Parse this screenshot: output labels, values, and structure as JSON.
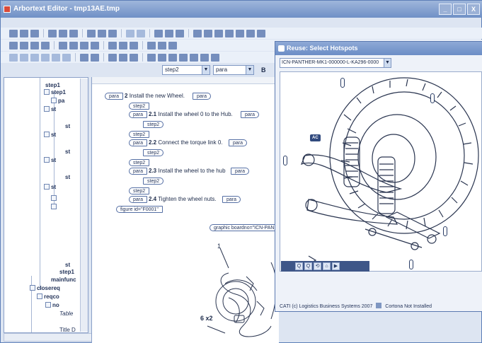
{
  "window": {
    "title": "Arbortext Editor - tmp13AE.tmp",
    "buttons": [
      "_",
      "□",
      "X"
    ]
  },
  "toolbar": {
    "style_combo": "step2",
    "element_combo": "para",
    "bold_label": "B"
  },
  "tree": {
    "rows": [
      {
        "label": "step1"
      },
      {
        "label": "step1"
      },
      {
        "label": "pa"
      },
      {
        "label": "st"
      },
      {
        "label": "st"
      },
      {
        "label": "st"
      },
      {
        "label": "st"
      },
      {
        "label": "st"
      },
      {
        "label": "st"
      },
      {
        "label": "st"
      },
      {
        "label": "step1"
      },
      {
        "label": "mainfunc"
      },
      {
        "label": "closereq"
      },
      {
        "label": "reqco"
      },
      {
        "label": "no"
      },
      {
        "label": "Table"
      },
      {
        "label": "Title D"
      }
    ]
  },
  "editor": {
    "tag_para": "para",
    "tag_step2": "step2",
    "lines": [
      {
        "num": "2",
        "text": "Install the new Wheel."
      },
      {
        "num": "2.1",
        "text": "Install the wheel 0 to the Hub."
      },
      {
        "num": "2.2",
        "text": "Connect the torque link 0."
      },
      {
        "num": "2.3",
        "text": "Install the wheel to the hub"
      },
      {
        "num": "2.4",
        "text": "Tighten the wheel nuts."
      }
    ],
    "figure_tag": "figure id=\"F0001\"",
    "graphic_tag": "graphic boardno=\"ICN-PAN",
    "drawing_labels": [
      "1",
      "6 x2"
    ]
  },
  "dialog": {
    "title": "Reuse: Select Hotspots",
    "hotspot_value": "ICN-PANTHER-MK1-000000-L-KA296-0000",
    "callout_label": "AC",
    "status": "CATI (c) Logistics Business Systems 2007",
    "plugin_status": "Cortona Not Installed",
    "viewer_tools": [
      "Q",
      "Q",
      "⟲",
      "⌂",
      "▶"
    ]
  },
  "colors": {
    "titlebar": "#6f90c6",
    "accent": "#314a7e"
  }
}
